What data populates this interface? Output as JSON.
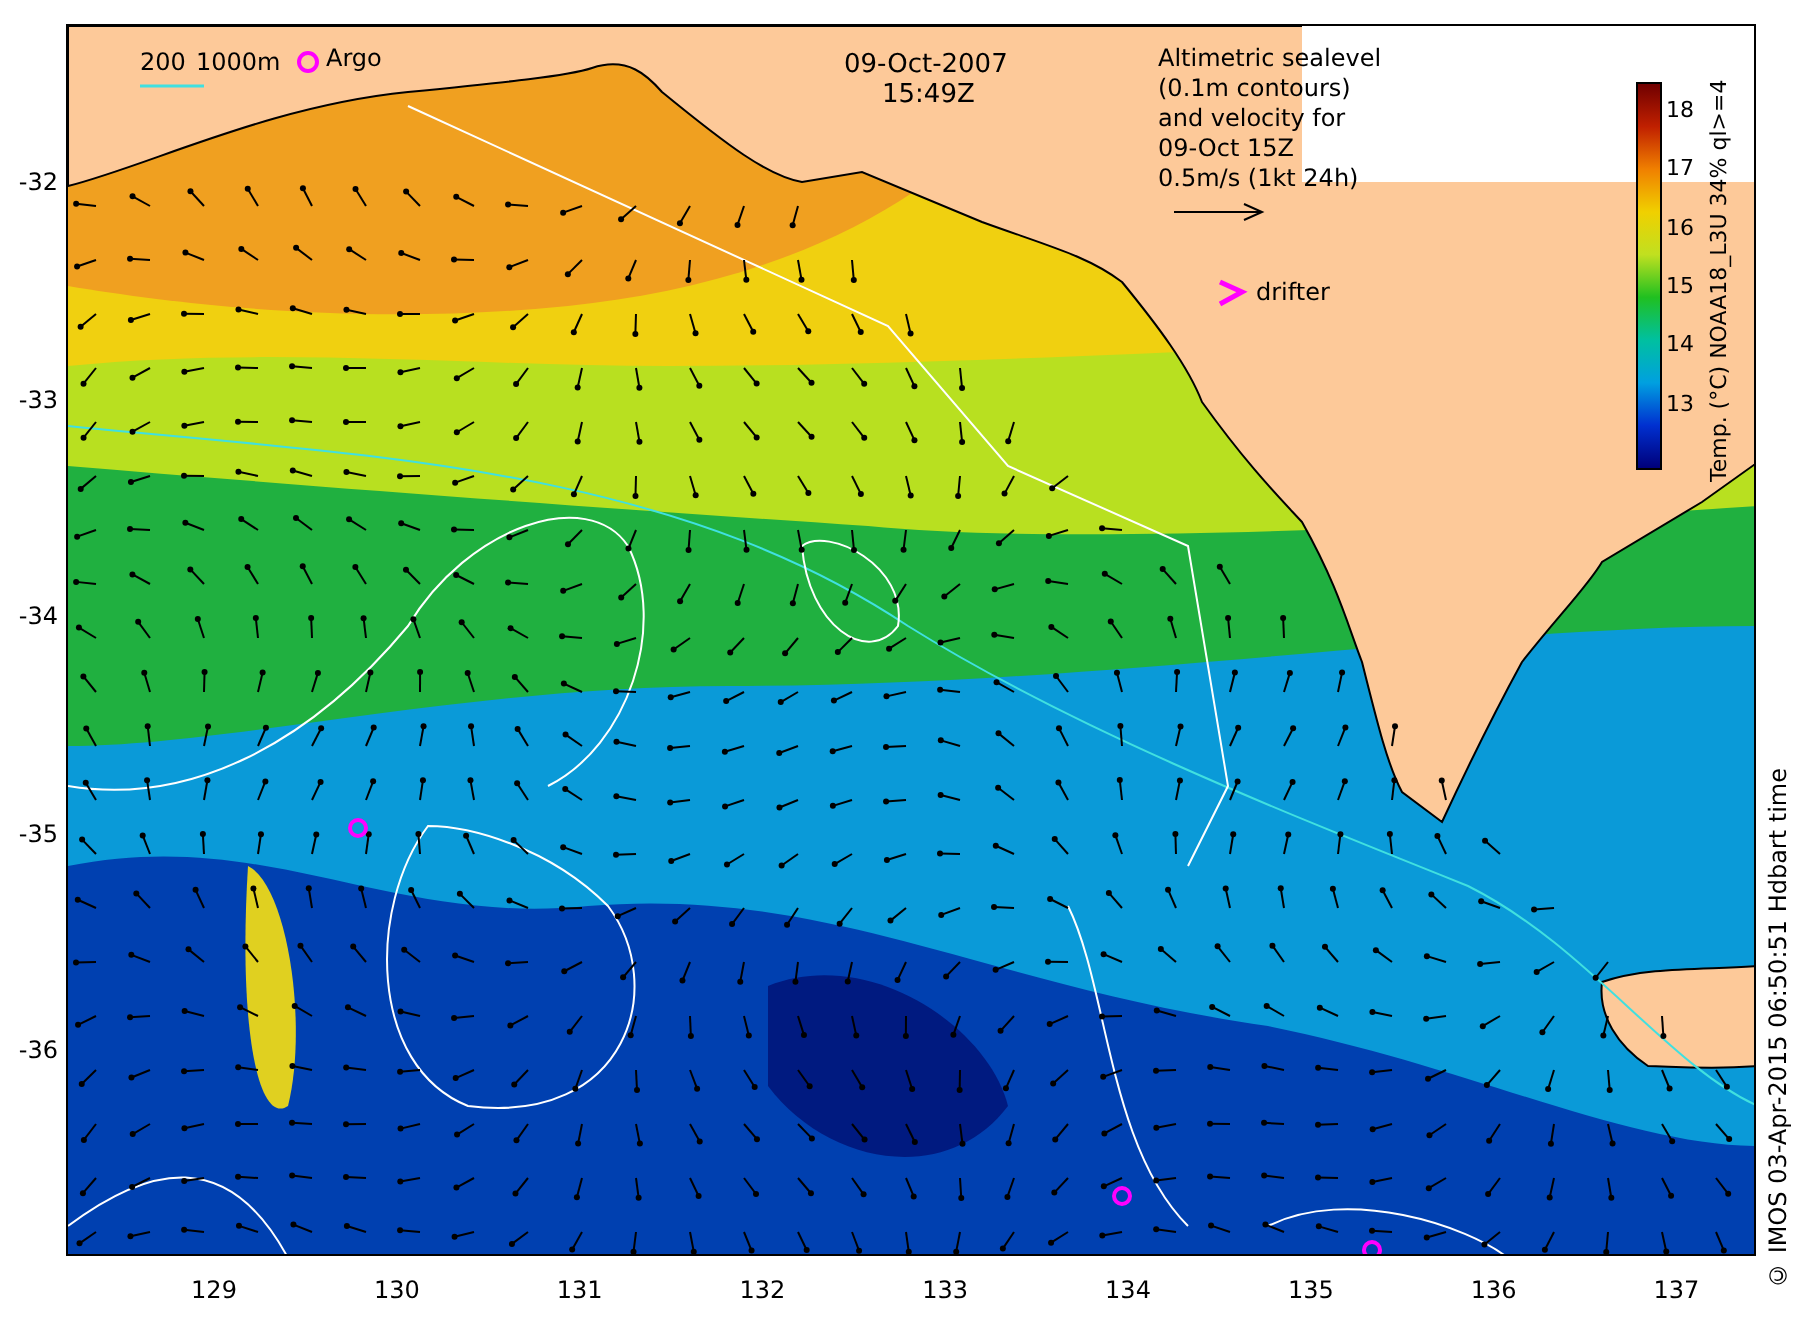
{
  "map": {
    "date": "09-Oct-2007",
    "time": "15:49Z",
    "legend": {
      "depth_labels": [
        "200",
        "1000m"
      ],
      "argo_label": "Argo"
    },
    "annotation": [
      "Altimetric sealevel",
      "(0.1m contours)",
      "and velocity for",
      "09-Oct 15Z",
      "0.5m/s (1kt 24h)"
    ],
    "drifter_label": "drifter"
  },
  "colorbar": {
    "label": "Temp. (°C) NOAA18_L3U 34% ql>=4",
    "ticks": [
      "18",
      "17",
      "16",
      "15",
      "14",
      "13"
    ]
  },
  "y_axis": {
    "ticks": [
      "-32",
      "-33",
      "-34",
      "-35",
      "-36"
    ]
  },
  "x_axis": {
    "ticks": [
      "129",
      "130",
      "131",
      "132",
      "133",
      "134",
      "135",
      "136",
      "137"
    ]
  },
  "credit": "© IMOS 03-Apr-2015 06:50:51 Hdbart time"
}
